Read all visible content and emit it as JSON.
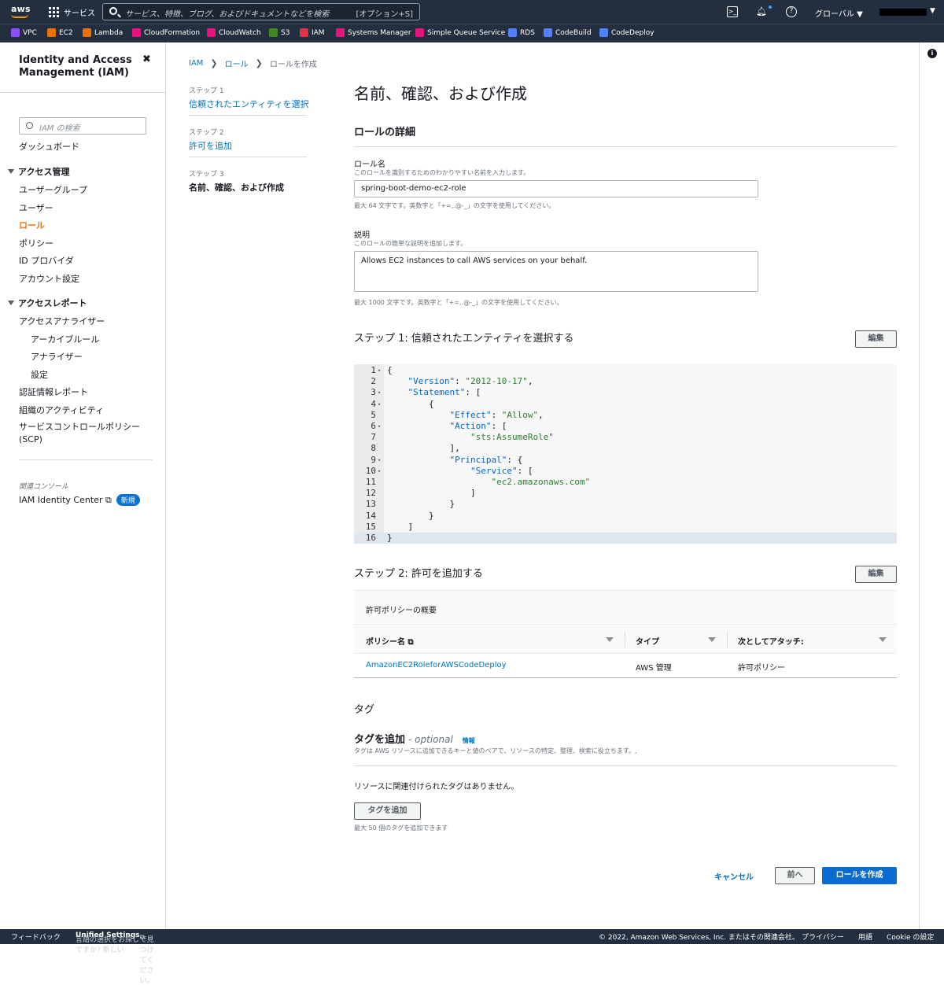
{
  "topbar": {
    "logo": "aws",
    "services_label": "サービス",
    "search_placeholder": "サービス、特徴、ブログ、およびドキュメントなどを検索",
    "search_shortcut": "[オプション+S]",
    "region": "グローバル ▼"
  },
  "favorites": [
    {
      "label": "VPC",
      "color": "#8c4fff"
    },
    {
      "label": "EC2",
      "color": "#ed7100"
    },
    {
      "label": "Lambda",
      "color": "#ed7100"
    },
    {
      "label": "CloudFormation",
      "color": "#e7157b"
    },
    {
      "label": "CloudWatch",
      "color": "#e7157b"
    },
    {
      "label": "S3",
      "color": "#3f8624"
    },
    {
      "label": "IAM",
      "color": "#dd344c"
    },
    {
      "label": "Systems Manager",
      "color": "#e7157b"
    },
    {
      "label": "Simple Queue Service",
      "color": "#e7157b"
    },
    {
      "label": "RDS",
      "color": "#527fff"
    },
    {
      "label": "CodeBuild",
      "color": "#527fff"
    },
    {
      "label": "CodeDeploy",
      "color": "#527fff"
    }
  ],
  "sidenav": {
    "title": "Identity and Access Management (IAM)",
    "search_placeholder": "IAM の検索",
    "dashboard": "ダッシュボード",
    "access_mgmt": "アクセス管理",
    "user_groups": "ユーザーグループ",
    "users": "ユーザー",
    "roles": "ロール",
    "policies": "ポリシー",
    "id_providers": "ID プロバイダ",
    "account_settings": "アカウント設定",
    "access_reports": "アクセスレポート",
    "access_analyzer": "アクセスアナライザー",
    "archive_rules": "アーカイブルール",
    "analyzers": "アナライザー",
    "settings": "設定",
    "credential_report": "認証情報レポート",
    "org_activity": "組織のアクティビティ",
    "scp": "サービスコントロールポリシー (SCP)",
    "related_console": "関連コンソール",
    "identity_center": "IAM Identity Center",
    "new_badge": "新規"
  },
  "breadcrumb": {
    "iam": "IAM",
    "roles": "ロール",
    "current": "ロールを作成"
  },
  "steps": [
    {
      "num": "ステップ 1",
      "title": "信頼されたエンティティを選択"
    },
    {
      "num": "ステップ 2",
      "title": "許可を追加"
    },
    {
      "num": "ステップ 3",
      "title": "名前、確認、および作成"
    }
  ],
  "page_title": "名前、確認、および作成",
  "role_details": {
    "heading": "ロールの詳細",
    "name_label": "ロール名",
    "name_desc": "このロールを識別するためのわかりやすい名前を入力します。",
    "name_value": "spring-boot-demo-ec2-role",
    "name_hint": "最大 64 文字です。英数字と「+=,.@-_」の文字を使用してください。",
    "desc_label": "説明",
    "desc_desc": "このロールの簡単な説明を追加します。",
    "desc_value": "Allows EC2 instances to call AWS services on your behalf.",
    "desc_hint": "最大 1000 文字です。英数字と「+=,.@-_」の文字を使用してください。"
  },
  "step1": {
    "heading": "ステップ 1: 信頼されたエンティティを選択する",
    "edit": "編集",
    "code_lines": [
      "{",
      "    \"Version\": \"2012-10-17\",",
      "    \"Statement\": [",
      "        {",
      "            \"Effect\": \"Allow\",",
      "            \"Action\": [",
      "                \"sts:AssumeRole\"",
      "            ],",
      "            \"Principal\": {",
      "                \"Service\": [",
      "                    \"ec2.amazonaws.com\"",
      "                ]",
      "            }",
      "        }",
      "    ]",
      "}"
    ]
  },
  "step2": {
    "heading": "ステップ 2: 許可を追加する",
    "edit": "編集",
    "summary": "許可ポリシーの概要",
    "columns": [
      "ポリシー名",
      "タイプ",
      "次としてアタッチ:"
    ],
    "rows": [
      {
        "name": "AmazonEC2RoleforAWSCodeDeploy",
        "type": "AWS 管理",
        "attach": "許可ポリシー"
      }
    ]
  },
  "tags": {
    "heading": "タグ",
    "add_heading": "タグを追加",
    "optional": "- optional",
    "info": "情報",
    "desc": "タグは AWS リソースに追加できるキーと値のペアで、リソースの特定、整理、検索に役立ちます。,",
    "empty": "リソースに関連付けられたタグはありません。",
    "add_button": "タグを追加",
    "limit": "最大 50 個のタグを追加できます"
  },
  "actions": {
    "cancel": "キャンセル",
    "prev": "前へ",
    "create": "ロールを作成"
  },
  "footer": {
    "feedback": "フィードバック",
    "lang_prefix": "言語の選択をお探しですか? 新しい",
    "unified": "Unified Settings",
    "lang_suffix": "で見つけてください。",
    "copyright": "© 2022, Amazon Web Services, Inc. またはその関連会社。",
    "privacy": "プライバシー",
    "terms": "用語",
    "cookie": "Cookie の設定"
  }
}
